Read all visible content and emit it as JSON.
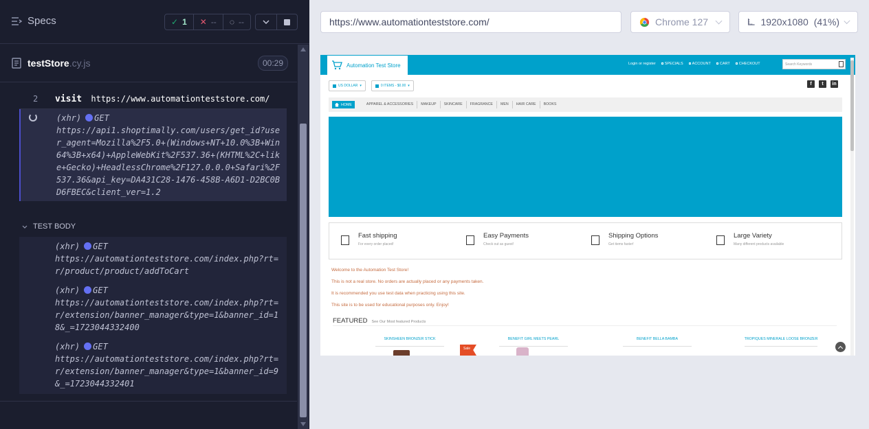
{
  "runner": {
    "specs_label": "Specs",
    "stats": {
      "passed": "1",
      "failed": "--",
      "pending": "--"
    },
    "spec_file": {
      "name": "testStore",
      "ext": ".cy.js",
      "duration": "00:29"
    },
    "commands": [
      {
        "num": "2",
        "name": "visit",
        "message": "https://www.automationteststore.com/"
      }
    ],
    "pending_xhr": {
      "label": "(xhr)",
      "method": "GET",
      "url": "https://api1.shoptimally.com/users/get_id?user_agent=Mozilla%2F5.0+(Windows+NT+10.0%3B+Win64%3B+x64)+AppleWebKit%2F537.36+(KHTML%2C+like+Gecko)+HeadlessChrome%2F127.0.0.0+Safari%2F537.36&api_key=DA431C28-1476-458B-A6D1-D2BC0BD6FBEC&client_ver=1.2"
    },
    "test_body_label": "TEST BODY",
    "body_xhrs": [
      {
        "label": "(xhr)",
        "method": "GET",
        "url": "https://automationteststore.com/index.php?rt=r/product/product/addToCart"
      },
      {
        "label": "(xhr)",
        "method": "GET",
        "url": "https://automationteststore.com/index.php?rt=r/extension/banner_manager&type=1&banner_id=18&_=1723044332400"
      },
      {
        "label": "(xhr)",
        "method": "GET",
        "url": "https://automationteststore.com/index.php?rt=r/extension/banner_manager&type=1&banner_id=9&_=1723044332401"
      }
    ]
  },
  "aut": {
    "url": "https://www.automationteststore.com/",
    "browser": "Chrome 127",
    "viewport": "1920x1080",
    "scale": "(41%)"
  },
  "site": {
    "logo_text": "Automation Test Store",
    "top_links": [
      "Login or register",
      "SPECIALS",
      "ACCOUNT",
      "CART",
      "CHECKOUT"
    ],
    "search_placeholder": "Search Keywords",
    "currency": "US DOLLAR",
    "cart": "0 ITEMS - $0.00",
    "nav": [
      "HOME",
      "APPAREL & ACCESSORIES",
      "MAKEUP",
      "SKINCARE",
      "FRAGRANCE",
      "MEN",
      "HAIR CARE",
      "BOOKS"
    ],
    "features": [
      {
        "title": "Fast shipping",
        "sub": "For every order placed!"
      },
      {
        "title": "Easy Payments",
        "sub": "Check out as guest!"
      },
      {
        "title": "Shipping Options",
        "sub": "Get items faster!"
      },
      {
        "title": "Large Variety",
        "sub": "Many different products available"
      }
    ],
    "welcome_lines": [
      "Welcome to the Automation Test Store!",
      "This is not a real store. No orders are actually placed or any payments taken.",
      "It is recommended you use test data when practicing using this site.",
      "This site is to be used for educational purposes only. Enjoy!"
    ],
    "featured_title": "FEATURED",
    "featured_sub": "See Our Most featured Products",
    "products": [
      "SKINSHEEN BRONZER STICK",
      "BENEFIT GIRL MEETS PEARL",
      "BENEFIT BELLA BAMBA",
      "TROPIQUES MINERALE LOOSE BRONZER"
    ],
    "sale_label": "Sale",
    "social": [
      "f",
      "t",
      "in"
    ]
  },
  "colors": {
    "brand": "#00a1cb",
    "runner_bg": "#1b1e2e",
    "pass": "#1fa971",
    "fail": "#e45770"
  }
}
